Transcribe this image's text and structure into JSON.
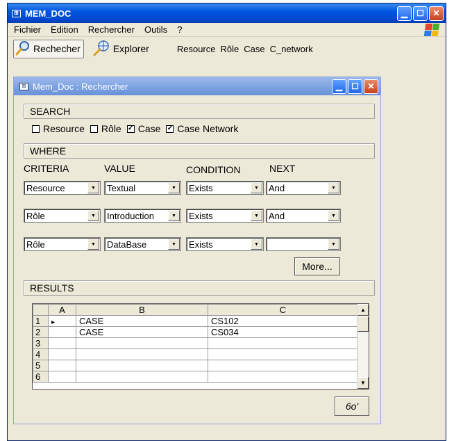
{
  "app": {
    "title": "MEM_DOC",
    "icon_glyph": "⊞",
    "menu": [
      "Fichier",
      "Edition",
      "Rechercher",
      "Outils",
      "?"
    ],
    "toolbar": {
      "search_label": "Rechecher",
      "explore_label": "Explorer",
      "links": [
        "Resource",
        "Rôle",
        "Case",
        "C_network"
      ]
    }
  },
  "dialog": {
    "title": "Mem_Doc : Rechercher",
    "search": {
      "header": "SEARCH",
      "options": [
        {
          "label": "Resource",
          "checked": false
        },
        {
          "label": "Rôle",
          "checked": false
        },
        {
          "label": "Case",
          "checked": true
        },
        {
          "label": "Case Network",
          "checked": true
        }
      ]
    },
    "where": {
      "header": "WHERE",
      "columns": [
        "CRITERIA",
        "VALUE",
        "CONDITION",
        "NEXT"
      ],
      "rows": [
        {
          "criteria": "Resource",
          "value": "Textual",
          "condition": "Exists",
          "next": "And"
        },
        {
          "criteria": "Rôle",
          "value": "Introduction",
          "condition": "Exists",
          "next": "And"
        },
        {
          "criteria": "Rôle",
          "value": "DataBase",
          "condition": "Exists",
          "next": ""
        }
      ],
      "more_label": "More..."
    },
    "results": {
      "header": "RESULTS",
      "columns": [
        "A",
        "B",
        "C"
      ],
      "row_numbers": [
        "1",
        "2",
        "3",
        "4",
        "5",
        "6"
      ],
      "current_marker": "▸",
      "rows": [
        {
          "a": "",
          "b": "CASE",
          "c": "CS102"
        },
        {
          "a": "",
          "b": "CASE",
          "c": "CS034"
        },
        {
          "a": "",
          "b": "",
          "c": ""
        },
        {
          "a": "",
          "b": "",
          "c": ""
        },
        {
          "a": "",
          "b": "",
          "c": ""
        },
        {
          "a": "",
          "b": "",
          "c": ""
        }
      ],
      "view_glyph": "6o'"
    }
  },
  "colors": {
    "titlebar": "#0055e0",
    "dialog_titlebar": "#7aa0e0",
    "window_bg": "#ece9d8",
    "close_button": "#c6401c"
  },
  "icons": {
    "search": "magnifier-icon",
    "explore": "globe-crosshair-icon",
    "view": "glasses-icon"
  }
}
